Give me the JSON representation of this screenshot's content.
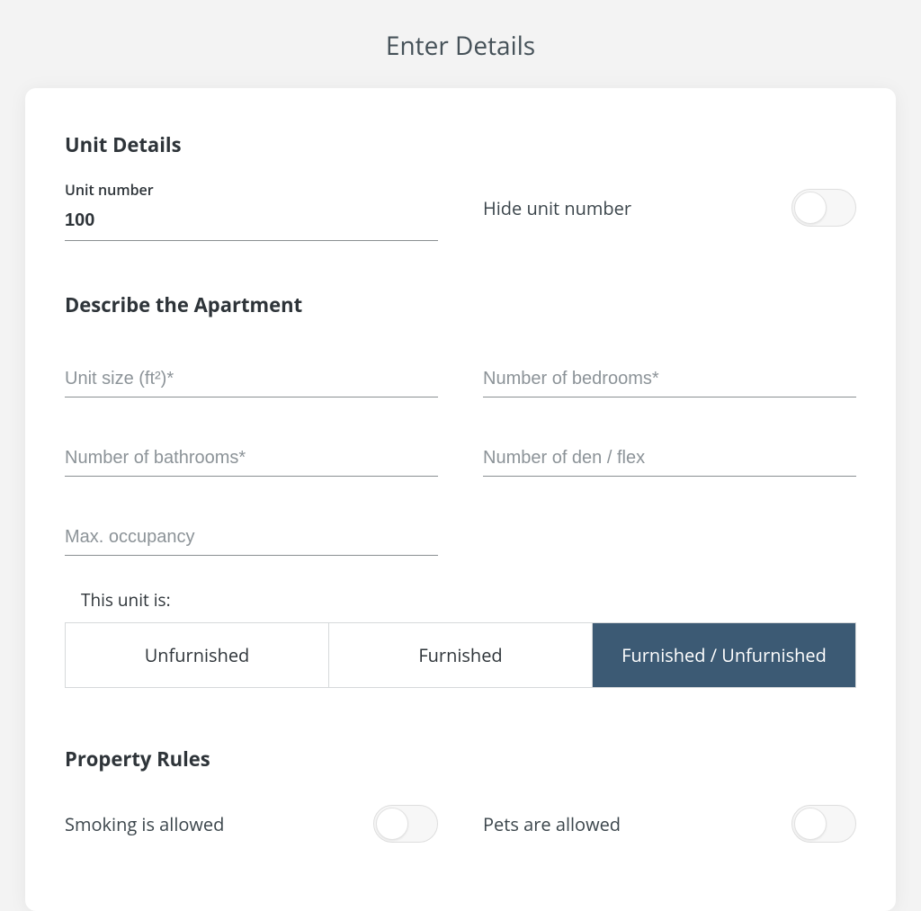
{
  "page_title": "Enter Details",
  "unit_details": {
    "heading": "Unit Details",
    "unit_number": {
      "label": "Unit number",
      "value": "100"
    },
    "hide_unit_number": {
      "label": "Hide unit number",
      "on": false
    }
  },
  "describe": {
    "heading": "Describe the Apartment",
    "unit_size": {
      "placeholder": "Unit size (ft²)*",
      "value": ""
    },
    "bedrooms": {
      "placeholder": "Number of bedrooms*",
      "value": ""
    },
    "bathrooms": {
      "placeholder": "Number of bathrooms*",
      "value": ""
    },
    "den_flex": {
      "placeholder": "Number of den / flex",
      "value": ""
    },
    "max_occupancy": {
      "placeholder": "Max. occupancy",
      "value": ""
    },
    "furnishing": {
      "caption": "This unit is:",
      "options": [
        "Unfurnished",
        "Furnished",
        "Furnished / Unfurnished"
      ],
      "selected_index": 2
    }
  },
  "rules": {
    "heading": "Property Rules",
    "smoking": {
      "label": "Smoking is allowed",
      "on": false
    },
    "pets": {
      "label": "Pets are allowed",
      "on": false
    }
  }
}
